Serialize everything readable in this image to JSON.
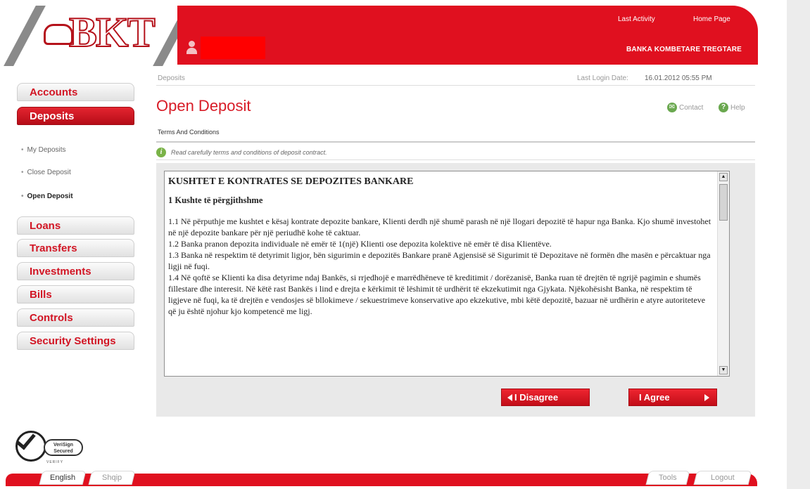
{
  "header": {
    "logo_text": "BKT",
    "last_activity": "Last Activity",
    "home_page": "Home Page",
    "bank_name": "BANKA KOMBETARE TREGTARE",
    "user_name_redacted": ""
  },
  "sidebar": {
    "tabs": [
      {
        "label": "Accounts",
        "active": false
      },
      {
        "label": "Deposits",
        "active": true
      },
      {
        "label": "Loans",
        "active": false
      },
      {
        "label": "Transfers",
        "active": false
      },
      {
        "label": "Investments",
        "active": false
      },
      {
        "label": "Bills",
        "active": false
      },
      {
        "label": "Controls",
        "active": false
      },
      {
        "label": "Security Settings",
        "active": false
      }
    ],
    "sub_items": [
      {
        "label": "My Deposits",
        "current": false
      },
      {
        "label": "Close Deposit",
        "current": false
      },
      {
        "label": "Open Deposit",
        "current": true
      }
    ]
  },
  "main": {
    "breadcrumb": "Deposits",
    "last_login_label": "Last Login Date:",
    "last_login_value": "16.01.2012 05:55 PM",
    "page_title": "Open Deposit",
    "contact_label": "Contact",
    "help_label": "Help",
    "section_label": "Terms And Conditions",
    "info_message": "Read carefully terms and conditions of deposit contract."
  },
  "terms": {
    "title": "KUSHTET E KONTRATES SE DEPOZITES BANKARE",
    "section_heading": "1 Kushte të përgjithshme",
    "paragraphs": [
      "1.1 Në përputhje me kushtet e kësaj kontrate depozite bankare, Klienti derdh një shumë parash në një llogari depozitë të hapur nga Banka. Kjo shumë investohet në një depozite bankare për një periudhë kohe të caktuar.",
      "1.2 Banka pranon depozita individuale në emër të 1(një) Klienti ose depozita kolektive në emër të disa Klientëve.",
      "1.3 Banka në respektim të detyrimit ligjor, bën sigurimin e depozitës Bankare pranë Agjensisë së Sigurimit të Depozitave në formën dhe masën e përcaktuar nga ligji në fuqi.",
      "1.4 Në qoftë se Klienti ka disa detyrime ndaj Bankës, si rrjedhojë e marrëdhëneve të kreditimit / dorëzanisë, Banka ruan të drejtën të ngrijë pagimin e shumës fillestare dhe interesit. Në këtë rast Bankës i lind e drejta e kërkimit të lëshimit të urdhërit të ekzekutimit nga Gjykata. Njëkohësisht Banka, në respektim të ligjeve në fuqi, ka të drejtën e vendosjes së bllokimeve / sekuestrimeve konservative apo ekzekutive, mbi këtë depozitë, bazuar në urdhërin e atyre autoriteteve që ju është njohur kjo kompetencë me ligj."
    ]
  },
  "buttons": {
    "disagree": "I Disagree",
    "agree": "I Agree"
  },
  "footer": {
    "verisign_line1": "VeriSign",
    "verisign_line2": "Secured",
    "verisign_verify": "VERIFY",
    "english": "English",
    "shqip": "Shqip",
    "tools": "Tools",
    "logout": "Logout"
  },
  "colors": {
    "brand_red": "#e0101f",
    "title_red": "#d81c27",
    "info_green": "#7ab348"
  }
}
